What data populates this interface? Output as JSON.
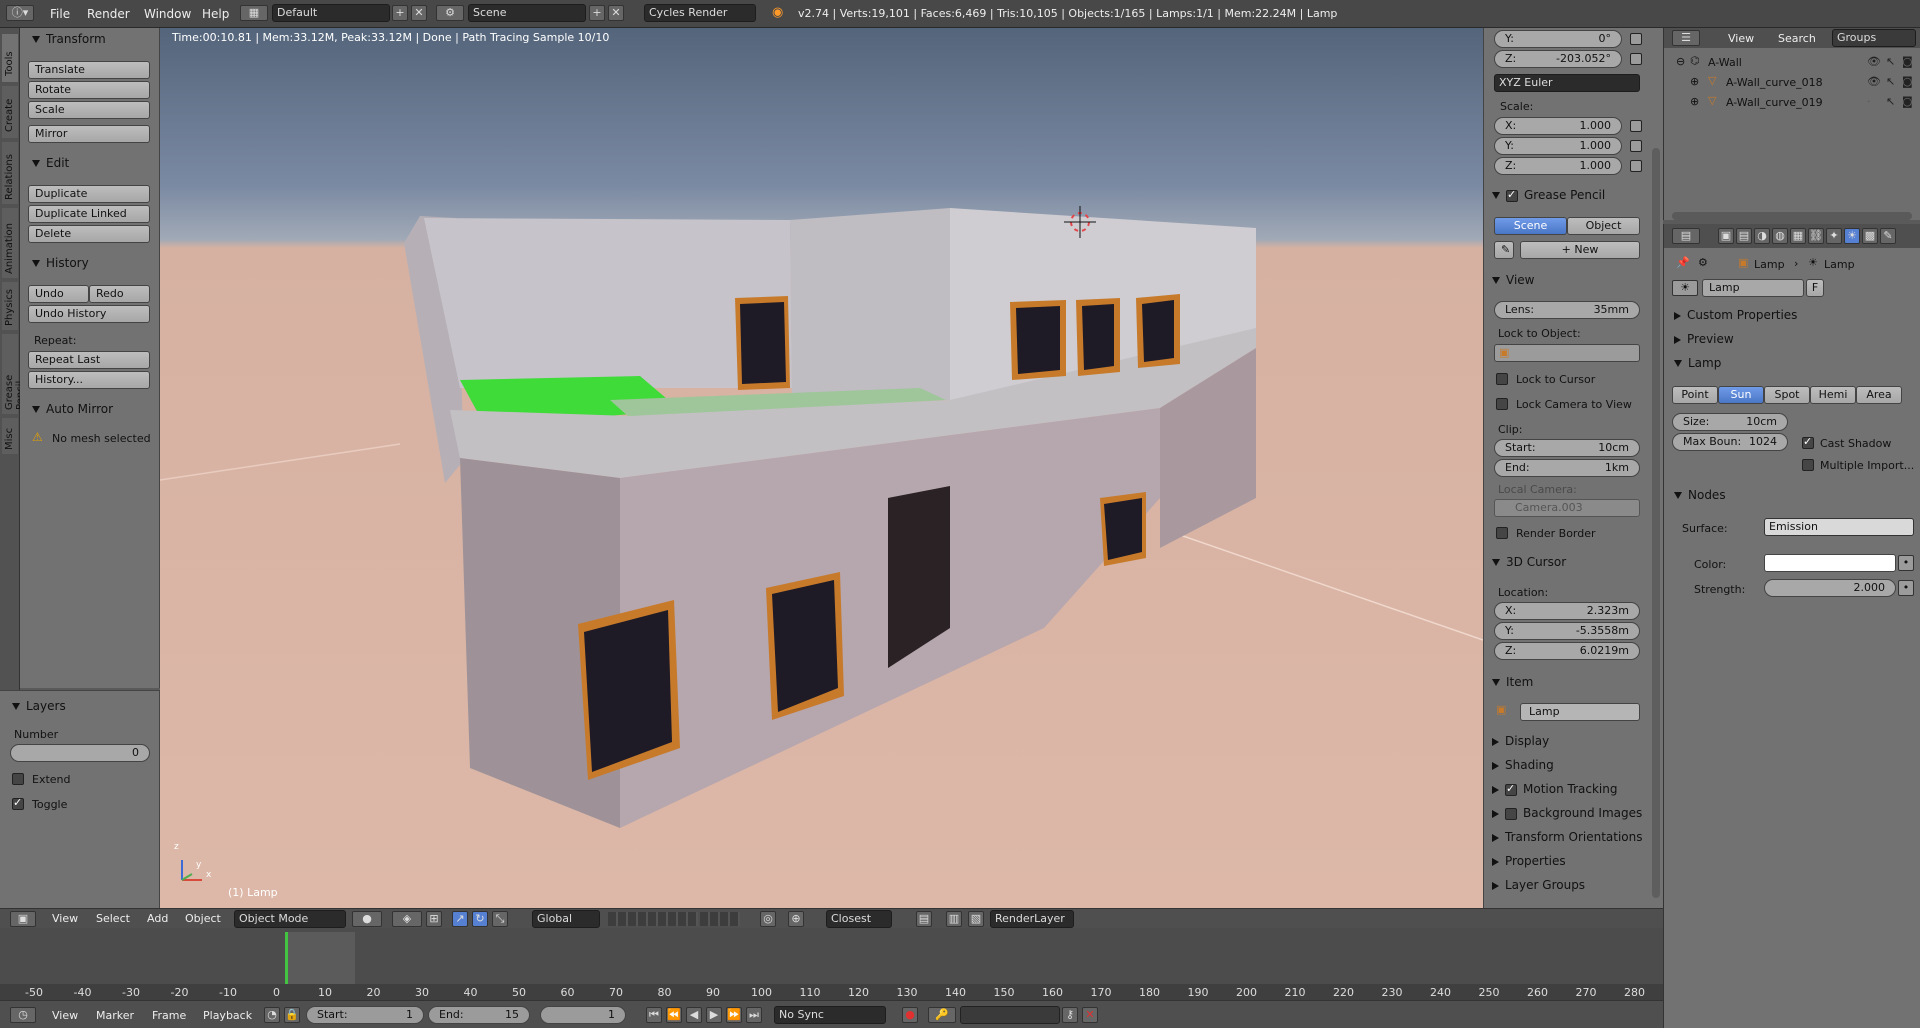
{
  "topbar": {
    "menus": [
      "File",
      "Render",
      "Window",
      "Help"
    ],
    "layout": "Default",
    "scene": "Scene",
    "engine": "Cycles Render",
    "stats": "v2.74 | Verts:19,101 | Faces:6,469 | Tris:10,105 | Objects:1/165 | Lamps:1/1 | Mem:22.24M | Lamp"
  },
  "tool_tabs": [
    "Tools",
    "Create",
    "Relations",
    "Animation",
    "Physics",
    "Grease Pencil",
    "Misc"
  ],
  "tools": {
    "transform_title": "Transform",
    "translate": "Translate",
    "rotate": "Rotate",
    "scale": "Scale",
    "mirror": "Mirror",
    "edit_title": "Edit",
    "duplicate": "Duplicate",
    "duplicate_linked": "Duplicate Linked",
    "delete": "Delete",
    "history_title": "History",
    "undo": "Undo",
    "redo": "Redo",
    "undo_history": "Undo History",
    "repeat_label": "Repeat:",
    "repeat_last": "Repeat Last",
    "history_btn": "History...",
    "auto_mirror_title": "Auto Mirror",
    "no_mesh": "No mesh selected"
  },
  "layers": {
    "title": "Layers",
    "number_label": "Number",
    "number_value": "0",
    "extend": "Extend",
    "toggle": "Toggle"
  },
  "viewport": {
    "render_info": "Time:00:10.81 | Mem:33.12M, Peak:33.12M | Done | Path Tracing Sample 10/10",
    "object_label": "(1) Lamp",
    "axis_x": "x",
    "axis_y": "y",
    "axis_z": "z"
  },
  "header3d": {
    "menus": [
      "View",
      "Select",
      "Add",
      "Object"
    ],
    "mode": "Object Mode",
    "orientation": "Global",
    "snap": "Closest",
    "render_layer": "RenderLayer"
  },
  "npanel": {
    "rot_y_label": "Y:",
    "rot_y": "0°",
    "rot_z_label": "Z:",
    "rot_z": "-203.052°",
    "rot_mode": "XYZ Euler",
    "scale_title": "Scale:",
    "scale_x": "1.000",
    "scale_y": "1.000",
    "scale_z": "1.000",
    "gp_title": "Grease Pencil",
    "gp_scene": "Scene",
    "gp_object": "Object",
    "gp_new": "New",
    "view_title": "View",
    "lens_label": "Lens:",
    "lens": "35mm",
    "lock_obj": "Lock to Object:",
    "lock_cursor": "Lock to Cursor",
    "lock_cam": "Lock Camera to View",
    "clip": "Clip:",
    "clip_start_label": "Start:",
    "clip_start": "10cm",
    "clip_end_label": "End:",
    "clip_end": "1km",
    "local_cam": "Local Camera:",
    "local_cam_value": "Camera.003",
    "render_border": "Render Border",
    "cursor_title": "3D Cursor",
    "location": "Location:",
    "cur_x": "2.323m",
    "cur_y": "-5.3558m",
    "cur_z": "6.0219m",
    "item_title": "Item",
    "item_name": "Lamp",
    "collapsed": [
      "Display",
      "Shading",
      "Motion Tracking",
      "Background Images",
      "Transform Orientations",
      "Properties",
      "Layer Groups"
    ]
  },
  "outliner": {
    "menus": [
      "View",
      "Search",
      "Groups"
    ],
    "items": [
      "A-Wall",
      "A-Wall_curve_018",
      "A-Wall_curve_019"
    ]
  },
  "properties": {
    "breadcrumb": [
      "Lamp",
      "Lamp"
    ],
    "datablock": "Lamp",
    "fake": "F",
    "custom_props": "Custom Properties",
    "preview": "Preview",
    "lamp_title": "Lamp",
    "types": [
      "Point",
      "Sun",
      "Spot",
      "Hemi",
      "Area"
    ],
    "selected_type": "Sun",
    "size_label": "Size:",
    "size": "10cm",
    "max_bounce_label": "Max Boun:",
    "max_bounce": "1024",
    "cast_shadow": "Cast Shadow",
    "multiple_import": "Multiple Import...",
    "nodes_title": "Nodes",
    "surface_label": "Surface:",
    "surface": "Emission",
    "color_label": "Color:",
    "strength_label": "Strength:",
    "strength": "2.000"
  },
  "timeline": {
    "ticks": [
      "-50",
      "-40",
      "-30",
      "-20",
      "-10",
      "0",
      "10",
      "20",
      "30",
      "40",
      "50",
      "60",
      "70",
      "80",
      "90",
      "100",
      "110",
      "120",
      "130",
      "140",
      "150",
      "160",
      "170",
      "180",
      "190",
      "200",
      "210",
      "220",
      "230",
      "240",
      "250",
      "260",
      "270",
      "280"
    ],
    "menus": [
      "View",
      "Marker",
      "Frame",
      "Playback"
    ],
    "start_label": "Start:",
    "start": "1",
    "end_label": "End:",
    "end": "15",
    "current": "1",
    "sync": "No Sync"
  },
  "colors": {
    "selected": "#5680d2",
    "grass": "#3edb39",
    "window_frame": "#c77a2a"
  }
}
